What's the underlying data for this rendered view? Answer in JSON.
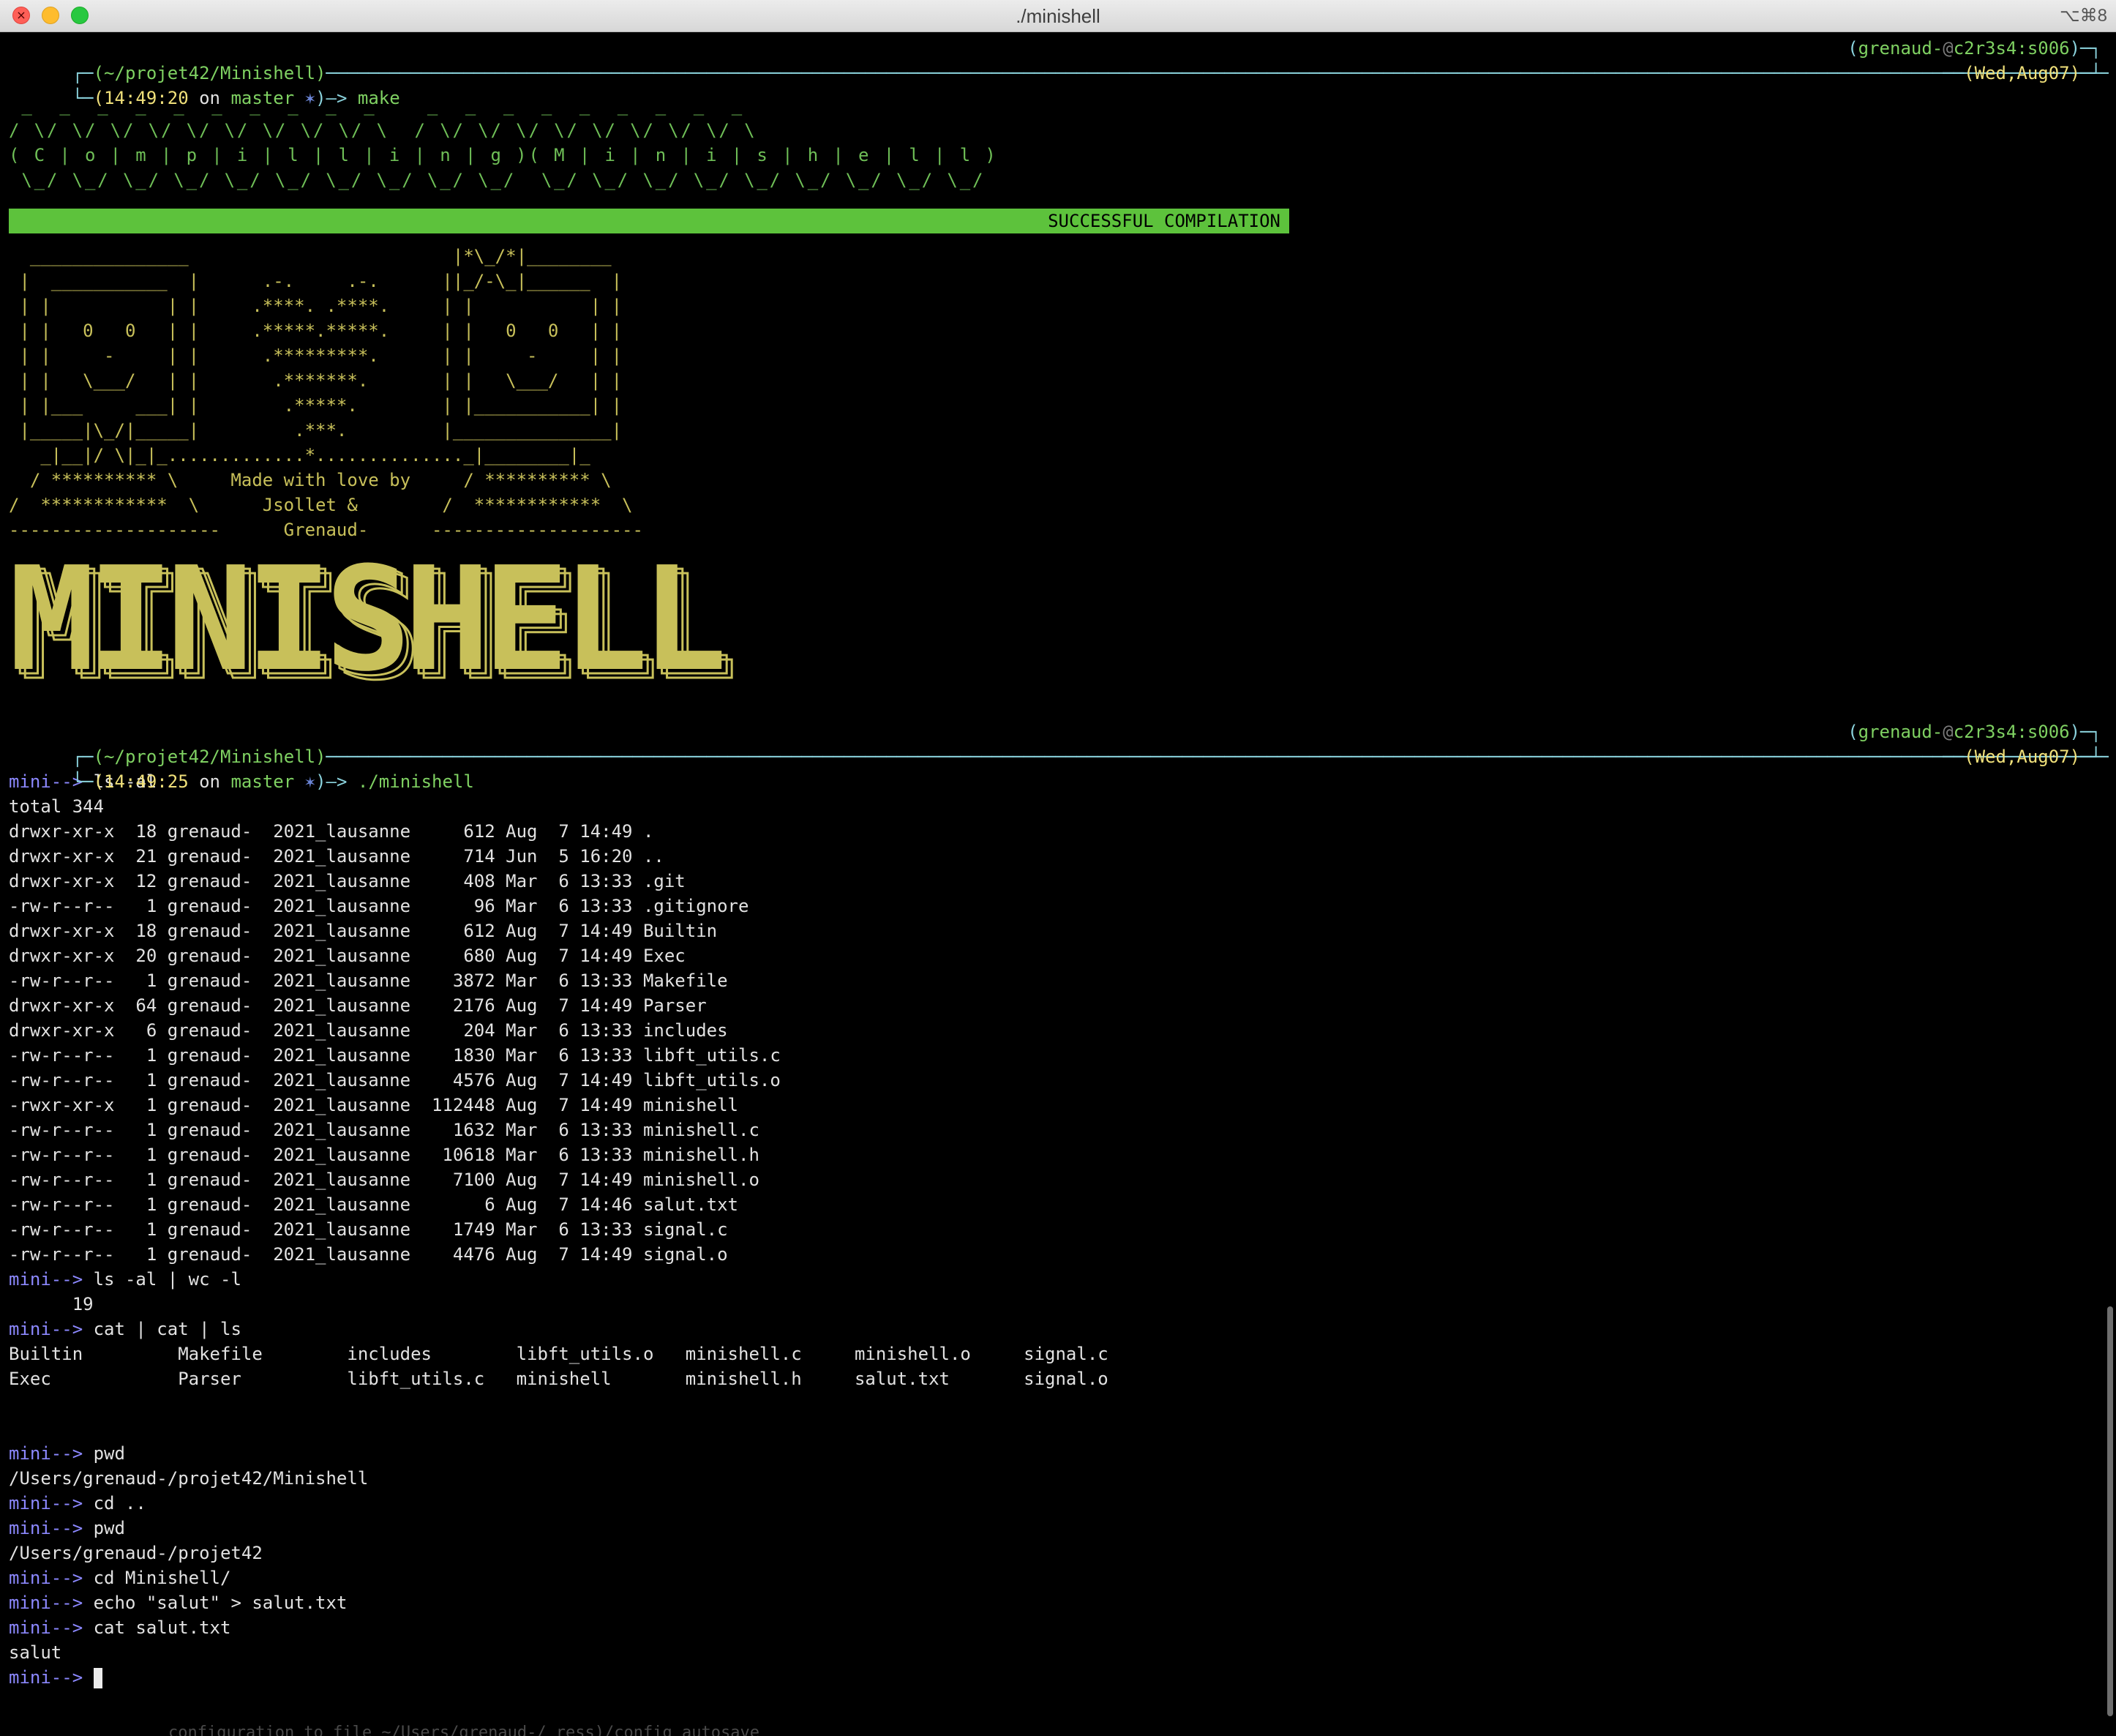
{
  "window": {
    "title": "./minishell",
    "shortcut": "⌥⌘8",
    "close_glyph": "×"
  },
  "prompt1": {
    "path": "(~/projet42/Minishell)",
    "time": "(14:49:20",
    "on": "on",
    "branch": "master",
    "dirty": "✶",
    "arrow": ")—>",
    "command": "make",
    "user": "grenaud-",
    "at": "@",
    "host": "c2r3s4:s006",
    "date": "(Wed,Aug07)"
  },
  "compile_art": [
    " _  _  _  _  _  _  _  _  _  _    _  _  _  _  _  _  _  _  _ ",
    "/ \\/ \\/ \\/ \\/ \\/ \\/ \\/ \\/ \\/ \\  / \\/ \\/ \\/ \\/ \\/ \\/ \\/ \\/ \\",
    "( C | o | m | p | i | l | l | i | n | g )( M | i | n | i | s | h | e | l | l )",
    " \\_/ \\_/ \\_/ \\_/ \\_/ \\_/ \\_/ \\_/ \\_/ \\_/  \\_/ \\_/ \\_/ \\_/ \\_/ \\_/ \\_/ \\_/ \\_/"
  ],
  "compile_status": "SUCCESSFUL COMPILATION",
  "banner_art": [
    "  _______________                         |*\\_/*|________",
    " |  ___________  |      .-.     .-.      ||_/-\\_|______  |",
    " | |           | |     .****. .****.     | |           | |",
    " | |   0   0   | |     .*****.*****.     | |   0   0   | |",
    " | |     -     | |      .*********.      | |     -     | |",
    " | |   \\___/   | |       .*******.       | |   \\___/   | |",
    " | |___     ___| |        .*****.        | |___________| |",
    " |_____|\\_/|_____|         .***.         |_______________|",
    "   _|__|/ \\|_|_.............*.............._|________|_",
    "  / ********** \\     Made with love by     / ********** \\",
    "/  ************  \\      Jsollet &        /  ************  \\",
    "--------------------      Grenaud-      --------------------"
  ],
  "big_title": "MINISHELL",
  "prompt2": {
    "path": "(~/projet42/Minishell)",
    "time": "(14:49:25",
    "on": "on",
    "branch": "master",
    "dirty": "✶",
    "arrow": ")—>",
    "command": "./minishell",
    "user": "grenaud-",
    "at": "@",
    "host": "c2r3s4:s006",
    "date": "(Wed,Aug07)"
  },
  "shell_prompt": "mini-->",
  "cmd_ls": "ls -al",
  "total": "total 344",
  "ls_rows": [
    "drwxr-xr-x  18 grenaud-  2021_lausanne     612 Aug  7 14:49 .",
    "drwxr-xr-x  21 grenaud-  2021_lausanne     714 Jun  5 16:20 ..",
    "drwxr-xr-x  12 grenaud-  2021_lausanne     408 Mar  6 13:33 .git",
    "-rw-r--r--   1 grenaud-  2021_lausanne      96 Mar  6 13:33 .gitignore",
    "drwxr-xr-x  18 grenaud-  2021_lausanne     612 Aug  7 14:49 Builtin",
    "drwxr-xr-x  20 grenaud-  2021_lausanne     680 Aug  7 14:49 Exec",
    "-rw-r--r--   1 grenaud-  2021_lausanne    3872 Mar  6 13:33 Makefile",
    "drwxr-xr-x  64 grenaud-  2021_lausanne    2176 Aug  7 14:49 Parser",
    "drwxr-xr-x   6 grenaud-  2021_lausanne     204 Mar  6 13:33 includes",
    "-rw-r--r--   1 grenaud-  2021_lausanne    1830 Mar  6 13:33 libft_utils.c",
    "-rw-r--r--   1 grenaud-  2021_lausanne    4576 Aug  7 14:49 libft_utils.o",
    "-rwxr-xr-x   1 grenaud-  2021_lausanne  112448 Aug  7 14:49 minishell",
    "-rw-r--r--   1 grenaud-  2021_lausanne    1632 Mar  6 13:33 minishell.c",
    "-rw-r--r--   1 grenaud-  2021_lausanne   10618 Mar  6 13:33 minishell.h",
    "-rw-r--r--   1 grenaud-  2021_lausanne    7100 Aug  7 14:49 minishell.o",
    "-rw-r--r--   1 grenaud-  2021_lausanne       6 Aug  7 14:46 salut.txt",
    "-rw-r--r--   1 grenaud-  2021_lausanne    1749 Mar  6 13:33 signal.c",
    "-rw-r--r--   1 grenaud-  2021_lausanne    4476 Aug  7 14:49 signal.o"
  ],
  "cmd_wc": "ls -al | wc -l",
  "wc_out": "      19",
  "cmd_cat": "cat | cat | ls",
  "cat_rows": [
    "Builtin         Makefile        includes        libft_utils.o   minishell.c     minishell.o     signal.c",
    "Exec            Parser          libft_utils.c   minishell       minishell.h     salut.txt       signal.o"
  ],
  "cmd_pwd1": "pwd",
  "pwd1_out": "/Users/grenaud-/projet42/Minishell",
  "cmd_cd1": "cd ..",
  "cmd_pwd2": "pwd",
  "pwd2_out": "/Users/grenaud-/projet42",
  "cmd_cd2": "cd Minishell/",
  "cmd_echo": "echo \"salut\" > salut.txt",
  "cmd_cat2": "cat salut.txt",
  "cat2_out": "salut",
  "bottom_fragment": "configuration to file ~/Users/grenaud-/ ress)/config autosave"
}
